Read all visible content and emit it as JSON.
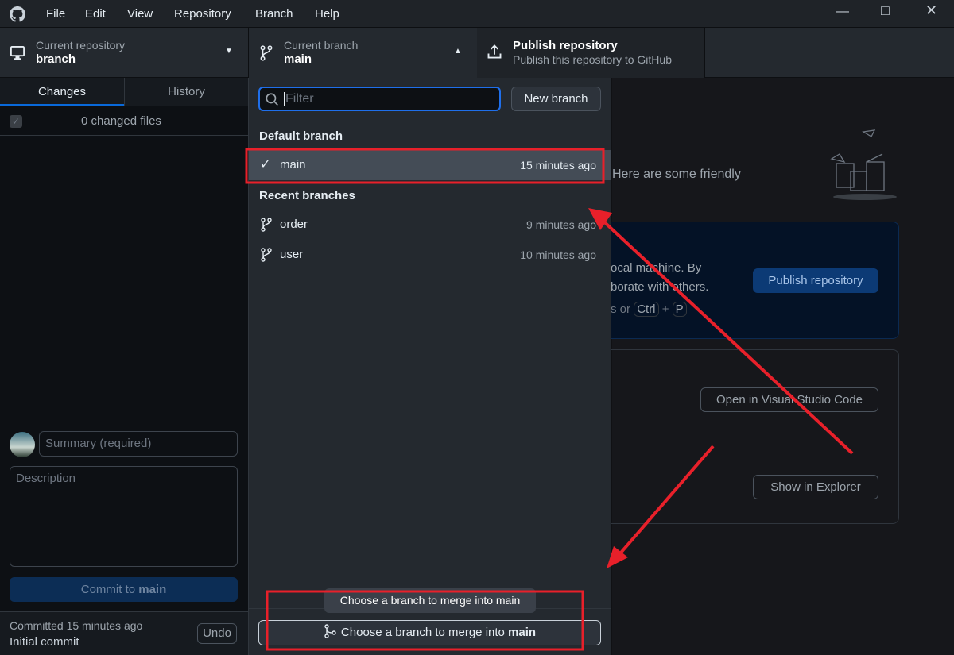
{
  "menu": [
    "File",
    "Edit",
    "View",
    "Repository",
    "Branch",
    "Help"
  ],
  "toolbar": {
    "repo_label": "Current repository",
    "repo_value": "branch",
    "branch_label": "Current branch",
    "branch_value": "main",
    "publish_title": "Publish repository",
    "publish_sub": "Publish this repository to GitHub"
  },
  "left": {
    "tabs": [
      "Changes",
      "History"
    ],
    "changed_files": "0 changed files",
    "summary_placeholder": "Summary (required)",
    "description_placeholder": "Description",
    "commit_prefix": "Commit to ",
    "commit_branch": "main",
    "last_commit_time": "Committed 15 minutes ago",
    "last_commit_msg": "Initial commit",
    "undo": "Undo"
  },
  "dropdown": {
    "filter_placeholder": "Filter",
    "new_branch": "New branch",
    "default_header": "Default branch",
    "default_branches": [
      {
        "name": "main",
        "time": "15 minutes ago",
        "checked": true
      }
    ],
    "recent_header": "Recent branches",
    "recent_branches": [
      {
        "name": "order",
        "time": "9 minutes ago"
      },
      {
        "name": "user",
        "time": "10 minutes ago"
      }
    ],
    "tooltip": "Choose a branch to merge into main",
    "merge_prefix": "Choose a branch to merge into ",
    "merge_branch": "main"
  },
  "main": {
    "intro": "Here are some friendly",
    "publish_line1": "ocal machine. By",
    "publish_line2": "borate with others.",
    "shortcut_prefix": "s or",
    "key1": "Ctrl",
    "plus": "+",
    "key2": "P",
    "publish_button": "Publish repository",
    "open_vscode": "Open in Visual Studio Code",
    "show_explorer": "Show in Explorer"
  },
  "colors": {
    "accent": "#0969da",
    "annotation": "#e8202a"
  }
}
